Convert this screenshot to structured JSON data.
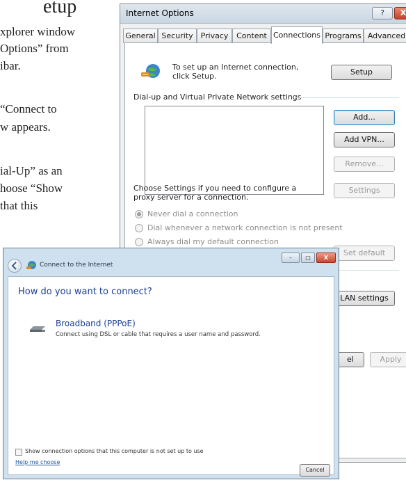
{
  "document": {
    "heading": "etup",
    "lines": [
      "xplorer window",
      "Options” from",
      "ibar.",
      "“Connect to",
      "w appears.",
      "ial-Up” as an",
      "hoose “Show",
      "that this"
    ]
  },
  "internet_options": {
    "title": "Internet Options",
    "help_button": "?",
    "close_button": "X",
    "tabs": [
      "General",
      "Security",
      "Privacy",
      "Content",
      "Connections",
      "Programs",
      "Advanced"
    ],
    "active_tab": "Connections",
    "setup_text": "To set up an Internet connection, click Setup.",
    "setup_button": "Setup",
    "vpn_section_label": "Dial-up and Virtual Private Network settings",
    "add_button": "Add...",
    "add_vpn_button": "Add VPN...",
    "remove_button": "Remove...",
    "proxy_text": "Choose Settings if you need to configure a proxy server for a connection.",
    "settings_button": "Settings",
    "radios": [
      {
        "label": "Never dial a connection",
        "checked": true
      },
      {
        "label": "Dial whenever a network connection is not present",
        "checked": false
      },
      {
        "label": "Always dial my default connection",
        "checked": false
      }
    ],
    "set_default_button": "Set default",
    "lan_settings_button": "LAN settings",
    "cancel_button_partial": "el",
    "apply_button": "Apply"
  },
  "connect_wizard": {
    "title": "Connect to the Internet",
    "minimize_button": "–",
    "maximize_button": "□",
    "close_button": "X",
    "heading": "How do you want to connect?",
    "option_title": "Broadband (PPPoE)",
    "option_description": "Connect using DSL or cable that requires a user name and password.",
    "checkbox_label": "Show connection options that this computer is not set up to use",
    "help_link": "Help me choose",
    "cancel_button": "Cancel"
  },
  "colors": {
    "wizard_heading": "#1c3f95",
    "link": "#1d58a6",
    "close_red": "#c7402a"
  }
}
